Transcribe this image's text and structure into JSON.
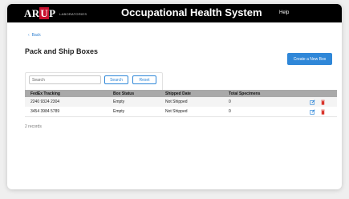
{
  "header": {
    "logo_text": "ARUP",
    "logo_sub": "LABORATORIES",
    "title": "Occupational Health System",
    "help": "Help"
  },
  "nav": {
    "back_label": "Back"
  },
  "page": {
    "title": "Pack and Ship Boxes",
    "create_label": "Create a New Box"
  },
  "search": {
    "placeholder": "Search",
    "value": "",
    "search_label": "Search",
    "reset_label": "Reset"
  },
  "table": {
    "columns": [
      "FedEx Tracking",
      "Box Status",
      "Shipped Date",
      "Total Specimens"
    ],
    "rows": [
      [
        "2240 9324 2304",
        "Empty",
        "Not Shipped",
        "0"
      ],
      [
        "3454 3984 5789",
        "Empty",
        "Not Shipped",
        "0"
      ]
    ]
  },
  "footer": {
    "records": "2 records"
  },
  "colors": {
    "accent": "#2f87d8",
    "brand_red": "#c8102e",
    "delete_red": "#d9342b"
  }
}
